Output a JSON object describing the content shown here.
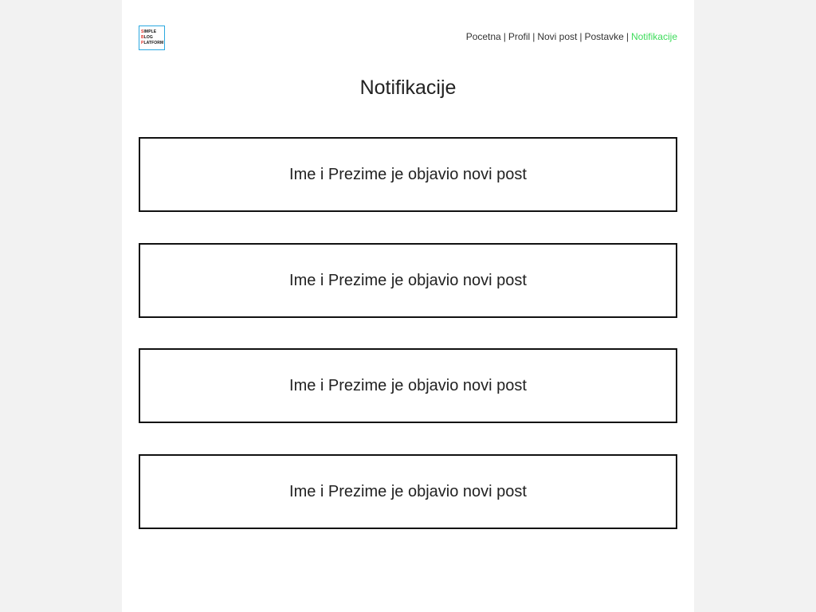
{
  "logo": {
    "line1_cap": "S",
    "line1_rest": "IMPLE",
    "line2_cap": "B",
    "line2_rest": "LOG",
    "line3_cap": "P",
    "line3_rest": "LATFORM"
  },
  "nav": {
    "items": [
      "Pocetna",
      "Profil",
      "Novi post",
      "Postavke",
      "Notifikacije"
    ],
    "separator": "|",
    "active_color": "#3ddc5a"
  },
  "page_title": "Notifikacije",
  "notifications": [
    {
      "text": "Ime i Prezime je objavio novi post"
    },
    {
      "text": "Ime i Prezime je objavio novi post"
    },
    {
      "text": "Ime i Prezime je objavio novi post"
    },
    {
      "text": "Ime i Prezime je objavio novi post"
    }
  ]
}
